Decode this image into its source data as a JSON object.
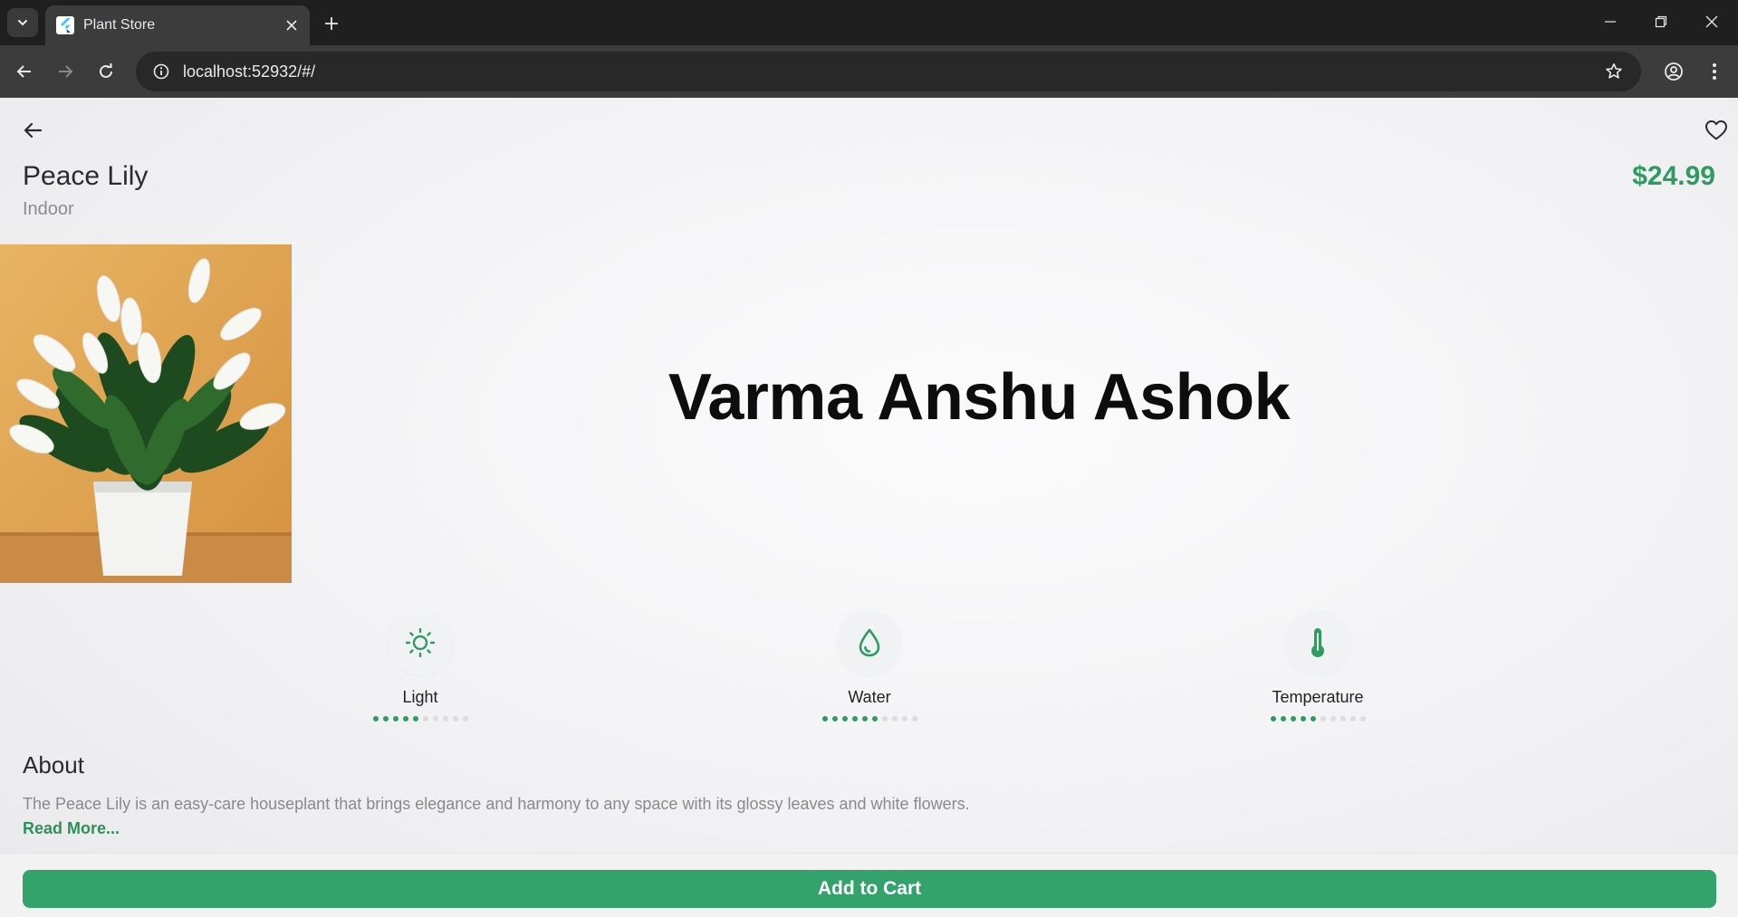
{
  "browser": {
    "tab_title": "Plant Store",
    "url": "localhost:52932/#/"
  },
  "plant": {
    "name": "Peace Lily",
    "category": "Indoor",
    "price": "$24.99",
    "overlay_text": "Varma Anshu Ashok"
  },
  "care": [
    {
      "label": "Light",
      "icon": "sun-icon",
      "level": 5,
      "max": 10
    },
    {
      "label": "Water",
      "icon": "water-drop-icon",
      "level": 6,
      "max": 10
    },
    {
      "label": "Temperature",
      "icon": "thermometer-icon",
      "level": 5,
      "max": 10
    }
  ],
  "about": {
    "title": "About",
    "text": "The Peace Lily is an easy-care houseplant that brings elegance and harmony to any space with its glossy leaves and white flowers.",
    "read_more": "Read More..."
  },
  "actions": {
    "add_to_cart": "Add to Cart"
  },
  "colors": {
    "accent": "#2f9b62",
    "button": "#33a36b",
    "chrome_dark": "#1f1f1f",
    "chrome_toolbar": "#3c3c3c"
  }
}
